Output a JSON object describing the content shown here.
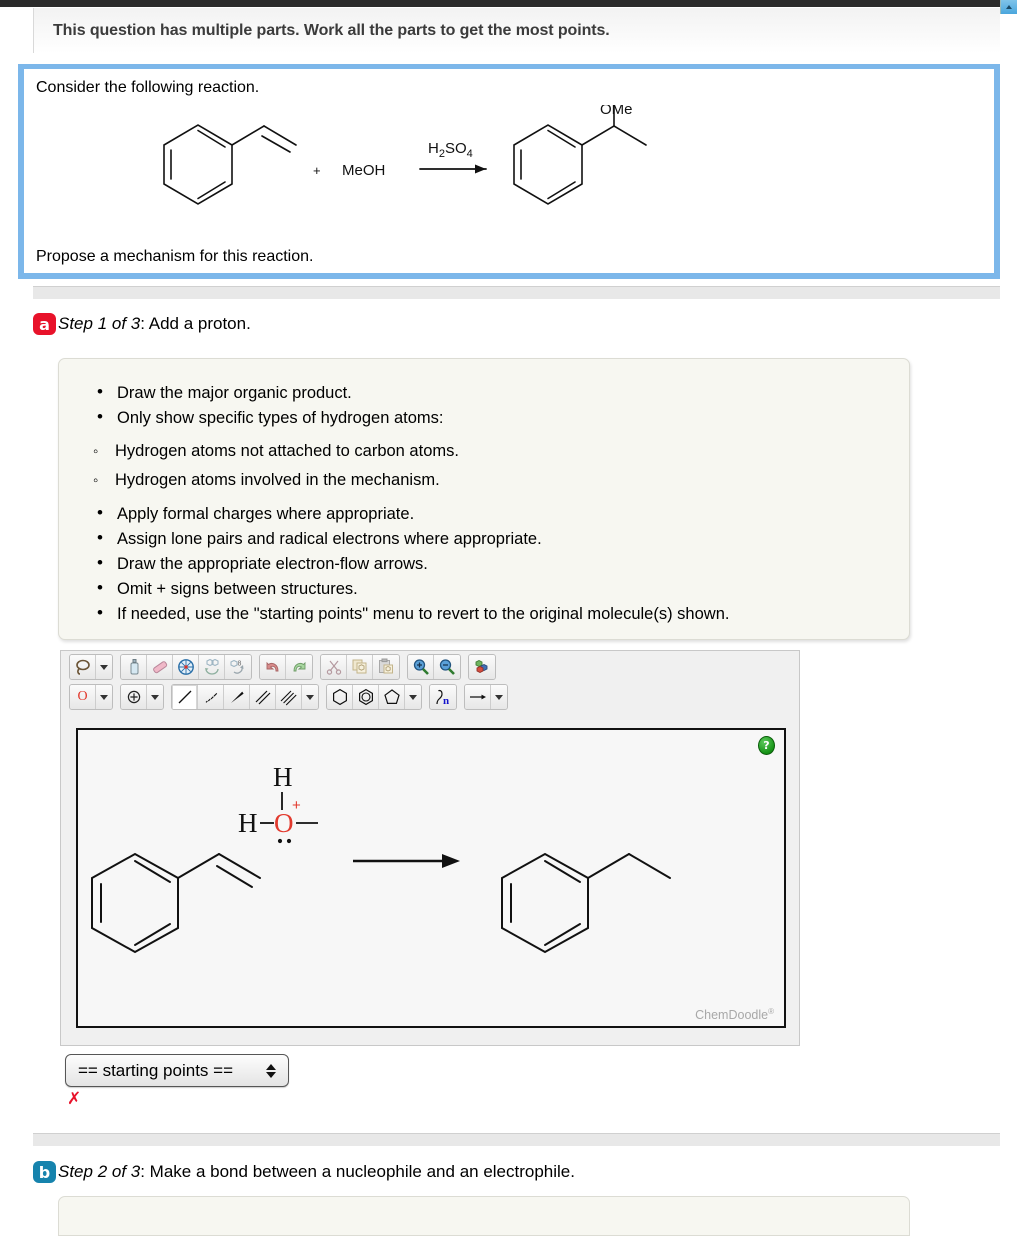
{
  "banner": {
    "text": "This question has multiple parts. Work all the parts to get the most points."
  },
  "question": {
    "intro": "Consider the following reaction.",
    "outro": "Propose a mechanism for this reaction.",
    "scheme": {
      "reactant_label": "",
      "plus_sign": "+",
      "coreagent": "MeOH",
      "reagent_above_arrow": "H2SO4",
      "reagent_above_arrow_parts": {
        "h": "H",
        "two": "2",
        "so": "SO",
        "four": "4"
      },
      "product_substituent": "OMe"
    }
  },
  "steps": [
    {
      "badge": "a",
      "badge_color": "#e8122a",
      "prefix": "Step 1 of 3",
      "suffix": ": Add a proton."
    },
    {
      "badge": "b",
      "badge_color": "#1683ad",
      "prefix": "Step 2 of 3",
      "suffix": ": Make a bond between a nucleophile and an electrophile."
    }
  ],
  "instructions": {
    "items": [
      "Draw the major organic product.",
      "Only show specific types of hydrogen atoms:"
    ],
    "subitems": [
      "Hydrogen atoms not attached to carbon atoms.",
      "Hydrogen atoms involved in the mechanism."
    ],
    "items_after": [
      "Apply formal charges where appropriate.",
      "Assign lone pairs and radical electrons where appropriate.",
      "Draw the appropriate electron-flow arrows.",
      "Omit + signs between structures.",
      "If needed, use the \"starting points\" menu to revert to the original molecule(s) shown."
    ]
  },
  "sketcher": {
    "toolbar_row1": [
      {
        "name": "lasso-select-icon",
        "label": "lasso select"
      },
      {
        "name": "chevron-down-icon",
        "label": "more select tools"
      },
      {
        "name": "clear-canvas-icon",
        "label": "clear"
      },
      {
        "name": "eraser-icon",
        "label": "erase"
      },
      {
        "name": "center-molecule-icon",
        "label": "center"
      },
      {
        "name": "flip-horizontal-icon",
        "label": "flip horizontal"
      },
      {
        "name": "flip-vertical-icon",
        "label": "flip vertical"
      },
      {
        "name": "undo-icon",
        "label": "undo"
      },
      {
        "name": "redo-icon",
        "label": "redo"
      },
      {
        "name": "cut-icon",
        "label": "cut"
      },
      {
        "name": "copy-icon",
        "label": "copy"
      },
      {
        "name": "paste-icon",
        "label": "paste"
      },
      {
        "name": "zoom-in-icon",
        "label": "zoom in"
      },
      {
        "name": "zoom-out-icon",
        "label": "zoom out"
      },
      {
        "name": "color-atoms-icon",
        "label": "color atoms"
      }
    ],
    "toolbar_row2": [
      {
        "name": "atom-label-o-icon",
        "label": "O"
      },
      {
        "name": "chevron-down-icon",
        "label": "more atom labels"
      },
      {
        "name": "charge-plus-icon",
        "label": "add charge"
      },
      {
        "name": "chevron-down-icon",
        "label": "more charge tools"
      },
      {
        "name": "single-bond-icon",
        "label": "single bond"
      },
      {
        "name": "hash-bond-icon",
        "label": "hashed wedge bond"
      },
      {
        "name": "wedge-bond-icon",
        "label": "wedge bond"
      },
      {
        "name": "double-bond-icon",
        "label": "double bond"
      },
      {
        "name": "triple-bond-icon",
        "label": "triple bond"
      },
      {
        "name": "chevron-down-icon",
        "label": "more bond tools"
      },
      {
        "name": "benzene-ring-icon",
        "label": "cyclohexane ring"
      },
      {
        "name": "aromatic-ring-icon",
        "label": "benzene ring"
      },
      {
        "name": "cyclopentane-ring-icon",
        "label": "cyclopentane ring"
      },
      {
        "name": "chevron-down-icon",
        "label": "more ring tools"
      },
      {
        "name": "electron-flow-arrow-icon",
        "label": "electron flow arrow"
      },
      {
        "name": "reaction-arrow-icon",
        "label": "reaction arrow"
      },
      {
        "name": "chevron-down-icon",
        "label": "more arrow tools"
      }
    ],
    "selected_tool": "single-bond-icon",
    "canvas": {
      "oxonium": {
        "h_top": "H",
        "h_left": "H",
        "o": "O",
        "charge": "+"
      },
      "watermark": "ChemDoodle",
      "watermark_mark": "®",
      "help_glyph": "?"
    }
  },
  "starting_points": {
    "selected": "== starting points ==",
    "options": [
      "== starting points =="
    ]
  },
  "grading": {
    "incorrect_mark": "✗"
  },
  "colors": {
    "accent_blue": "#7cb7ea",
    "badge_red": "#e8122a",
    "badge_blue": "#1683ad",
    "oxygen_red": "#e23a2e",
    "incorrect_red": "#e8122a",
    "panel_bg": "#f7f7f1"
  }
}
